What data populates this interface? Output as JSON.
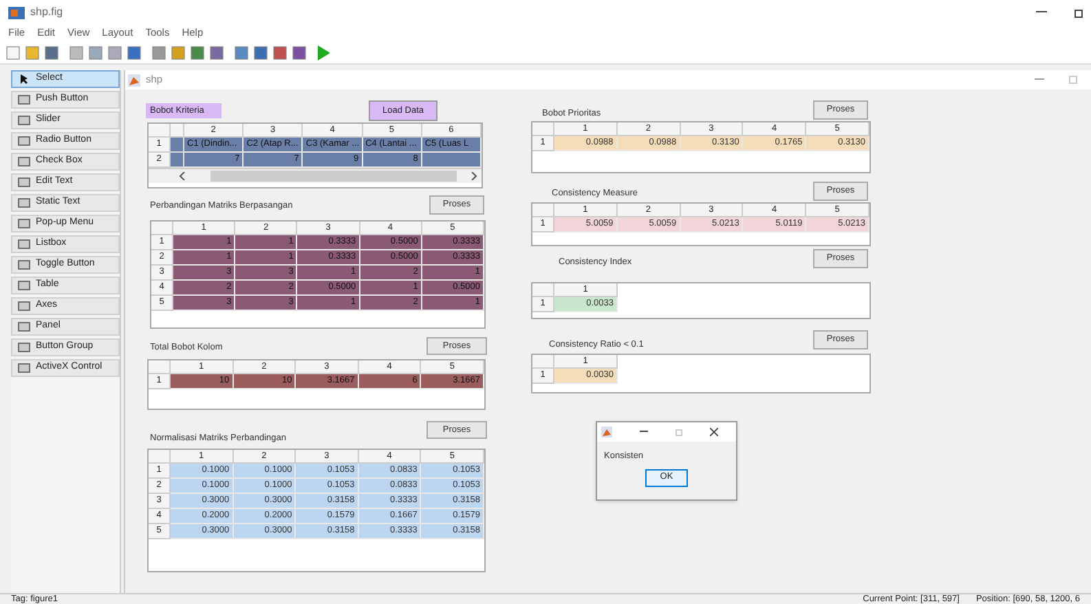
{
  "window": {
    "title": "shp.fig"
  },
  "menu": [
    "File",
    "Edit",
    "View",
    "Layout",
    "Tools",
    "Help"
  ],
  "palette": [
    {
      "label": "Select",
      "selected": true
    },
    {
      "label": "Push Button",
      "selected": false
    },
    {
      "label": "Slider",
      "selected": false
    },
    {
      "label": "Radio Button",
      "selected": false
    },
    {
      "label": "Check Box",
      "selected": false
    },
    {
      "label": "Edit Text",
      "selected": false
    },
    {
      "label": "Static Text",
      "selected": false
    },
    {
      "label": "Pop-up Menu",
      "selected": false
    },
    {
      "label": "Listbox",
      "selected": false
    },
    {
      "label": "Toggle Button",
      "selected": false
    },
    {
      "label": "Table",
      "selected": false
    },
    {
      "label": "Axes",
      "selected": false
    },
    {
      "label": "Panel",
      "selected": false
    },
    {
      "label": "Button Group",
      "selected": false
    },
    {
      "label": "ActiveX Control",
      "selected": false
    }
  ],
  "figure": {
    "title": "shp"
  },
  "panels": [
    {
      "kind": "input",
      "label": "Bobot Kriteria",
      "button": "Load Data",
      "table": {
        "color": "#6a7fa8",
        "columns": [
          "2",
          "3",
          "4",
          "5",
          "6"
        ],
        "rows": [
          {
            "header": "1",
            "kind": "text",
            "cells": [
              "C1 (Dindin...",
              "C2 (Atap R...",
              "C3 (Kamar ...",
              "C4 (Lantai ...",
              "C5 (Luas L"
            ]
          },
          {
            "header": "2",
            "kind": "number",
            "cells": [
              "7",
              "7",
              "9",
              "8"
            ]
          }
        ]
      }
    },
    {
      "kind": "result",
      "label": "Perbandingan Matriks Berpasangan",
      "button": "Proses",
      "table": {
        "color": "#8a5a74",
        "columns": [
          "1",
          "2",
          "3",
          "4",
          "5"
        ],
        "rows": [
          {
            "header": "1",
            "cells": [
              "1",
              "1",
              "0.3333",
              "0.5000",
              "0.3333"
            ]
          },
          {
            "header": "2",
            "cells": [
              "1",
              "1",
              "0.3333",
              "0.5000",
              "0.3333"
            ]
          },
          {
            "header": "3",
            "cells": [
              "3",
              "3",
              "1",
              "2",
              "1"
            ]
          },
          {
            "header": "4",
            "cells": [
              "2",
              "2",
              "0.5000",
              "1",
              "0.5000"
            ]
          },
          {
            "header": "5",
            "cells": [
              "3",
              "3",
              "1",
              "2",
              "1"
            ]
          }
        ]
      }
    },
    {
      "kind": "result",
      "label": "Total Bobot Kolom",
      "button": "Proses",
      "table": {
        "color": "#9a5c5c",
        "columns": [
          "1",
          "2",
          "3",
          "4",
          "5"
        ],
        "rows": [
          {
            "header": "1",
            "cells": [
              "10",
              "10",
              "3.1667",
              "6",
              "3.1667"
            ]
          }
        ]
      }
    },
    {
      "kind": "result",
      "label": "Normalisasi Matriks Perbandingan",
      "button": "Proses",
      "table": {
        "color": "#bcd6f2",
        "columns": [
          "1",
          "2",
          "3",
          "4",
          "5"
        ],
        "rows": [
          {
            "header": "1",
            "cells": [
              "0.1000",
              "0.1000",
              "0.1053",
              "0.0833",
              "0.1053"
            ]
          },
          {
            "header": "2",
            "cells": [
              "0.1000",
              "0.1000",
              "0.1053",
              "0.0833",
              "0.1053"
            ]
          },
          {
            "header": "3",
            "cells": [
              "0.3000",
              "0.3000",
              "0.3158",
              "0.3333",
              "0.3158"
            ]
          },
          {
            "header": "4",
            "cells": [
              "0.2000",
              "0.2000",
              "0.1579",
              "0.1667",
              "0.1579"
            ]
          },
          {
            "header": "5",
            "cells": [
              "0.3000",
              "0.3000",
              "0.3158",
              "0.3333",
              "0.3158"
            ]
          }
        ]
      }
    },
    {
      "kind": "result",
      "label": "Bobot Prioritas",
      "button": "Proses",
      "table": {
        "color": "#f5ddb9",
        "columns": [
          "1",
          "2",
          "3",
          "4",
          "5"
        ],
        "rows": [
          {
            "header": "1",
            "cells": [
              "0.0988",
              "0.0988",
              "0.3130",
              "0.1765",
              "0.3130"
            ]
          }
        ]
      }
    },
    {
      "kind": "result",
      "label": "Consistency Measure",
      "button": "Proses",
      "table": {
        "color": "#f1d5d8",
        "columns": [
          "1",
          "2",
          "3",
          "4",
          "5"
        ],
        "rows": [
          {
            "header": "1",
            "cells": [
              "5.0059",
              "5.0059",
              "5.0213",
              "5.0119",
              "5.0213"
            ]
          }
        ]
      }
    },
    {
      "kind": "result",
      "label": "Consistency Index",
      "button": "Proses",
      "table": {
        "color": "#c9e7cc",
        "columns": [
          "1"
        ],
        "rows": [
          {
            "header": "1",
            "cells": [
              "0.0033"
            ]
          }
        ]
      }
    },
    {
      "kind": "result",
      "label": "Consistency Ratio < 0.1",
      "button": "Proses",
      "table": {
        "color": "#f5ddb9",
        "columns": [
          "1"
        ],
        "rows": [
          {
            "header": "1",
            "cells": [
              "0.0030"
            ]
          }
        ]
      }
    }
  ],
  "dialog": {
    "message": "Konsisten",
    "button": "OK"
  },
  "status_bar": {
    "tag": "Tag: figure1",
    "current_point": "Current Point: [311, 597]",
    "position": "Position: [690, 58, 1200, 6"
  }
}
